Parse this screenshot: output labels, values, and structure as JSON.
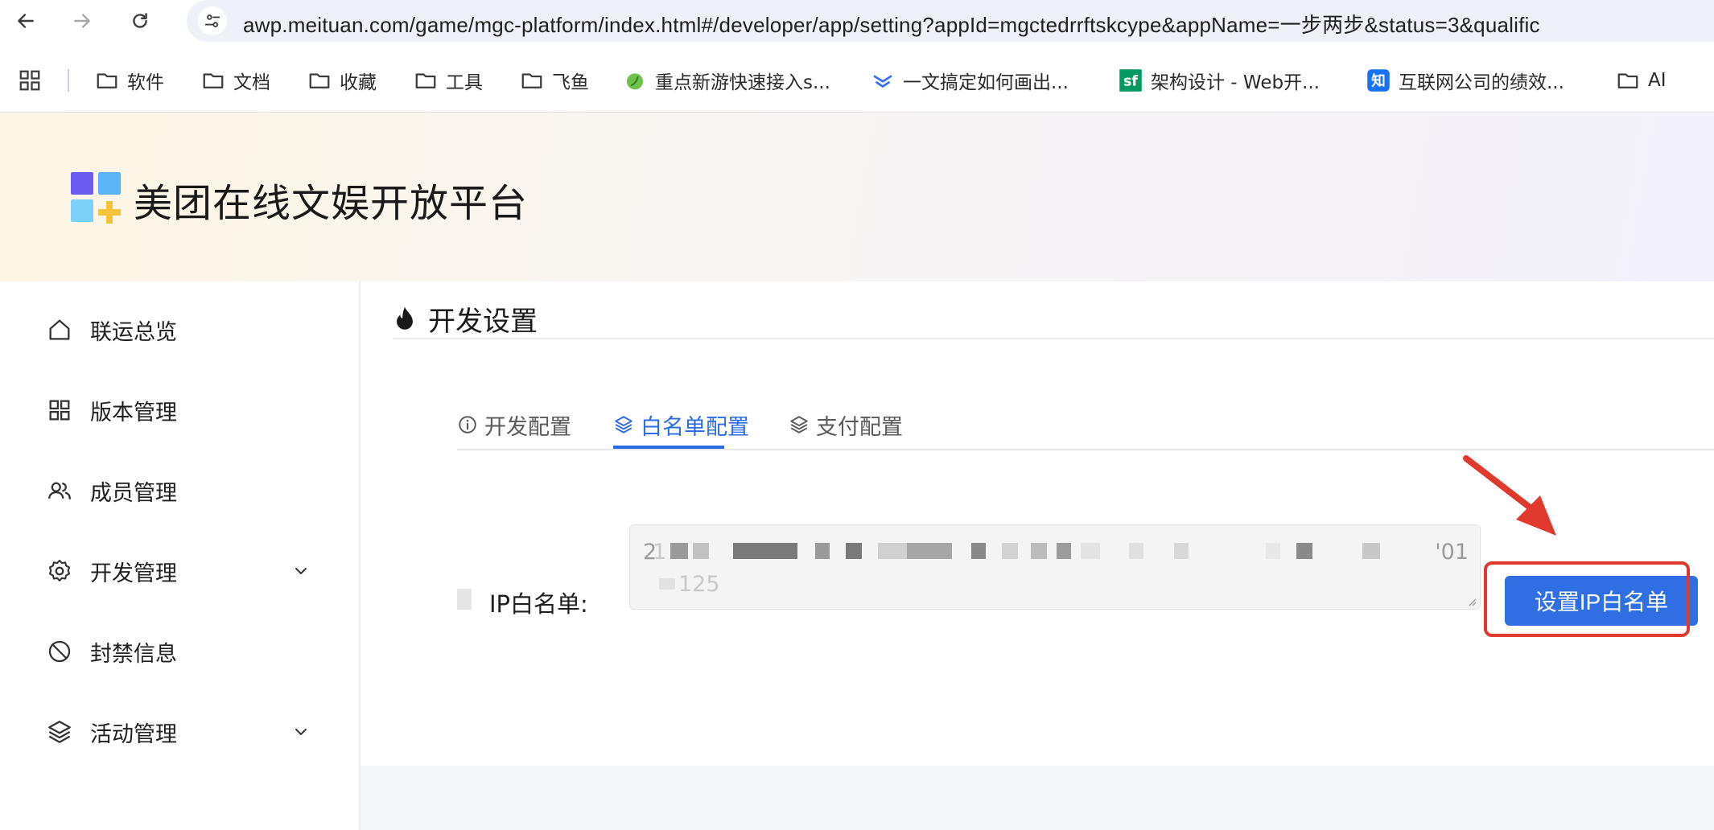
{
  "browser": {
    "url": "awp.meituan.com/game/mgc-platform/index.html#/developer/app/setting?appId=mgctedrrftskcype&appName=一步两步&status=3&qualific",
    "bookmarks": [
      {
        "label": "软件",
        "icon": "folder-icon"
      },
      {
        "label": "文档",
        "icon": "folder-icon"
      },
      {
        "label": "收藏",
        "icon": "folder-icon"
      },
      {
        "label": "工具",
        "icon": "folder-icon"
      },
      {
        "label": "飞鱼",
        "icon": "folder-icon"
      },
      {
        "label": "重点新游快速接入s...",
        "icon": "leaf-favicon"
      },
      {
        "label": "一文搞定如何画出...",
        "icon": "lark-favicon"
      },
      {
        "label": "架构设计 - Web开...",
        "icon": "sf-favicon"
      },
      {
        "label": "互联网公司的绩效...",
        "icon": "zhihu-favicon"
      },
      {
        "label": "AI",
        "icon": "folder-icon"
      }
    ],
    "favicon_texts": {
      "sf": "sf",
      "zhihu": "知"
    }
  },
  "header": {
    "platform_title": "美团在线文娱开放平台"
  },
  "sidebar": {
    "items": [
      {
        "label": "联运总览",
        "icon": "home-icon"
      },
      {
        "label": "版本管理",
        "icon": "grid-icon"
      },
      {
        "label": "成员管理",
        "icon": "users-icon"
      },
      {
        "label": "开发管理",
        "icon": "gear-icon",
        "expandable": true
      },
      {
        "label": "封禁信息",
        "icon": "ban-icon"
      },
      {
        "label": "活动管理",
        "icon": "layers-icon",
        "expandable": true
      }
    ]
  },
  "main": {
    "page_title": "开发设置",
    "tabs": [
      {
        "label": "开发配置",
        "icon": "info-icon"
      },
      {
        "label": "白名单配置",
        "icon": "layers-icon",
        "active": true
      },
      {
        "label": "支付配置",
        "icon": "layers-icon"
      }
    ],
    "ip_whitelist": {
      "label": "IP白名单:",
      "value_visible_fragments": [
        "2",
        "'01",
        "1",
        "125"
      ],
      "button_label": "设置IP白名单"
    }
  },
  "colors": {
    "accent": "#2f6fe3",
    "tab_active": "#2a6be6",
    "annotation": "#e03a2f"
  }
}
